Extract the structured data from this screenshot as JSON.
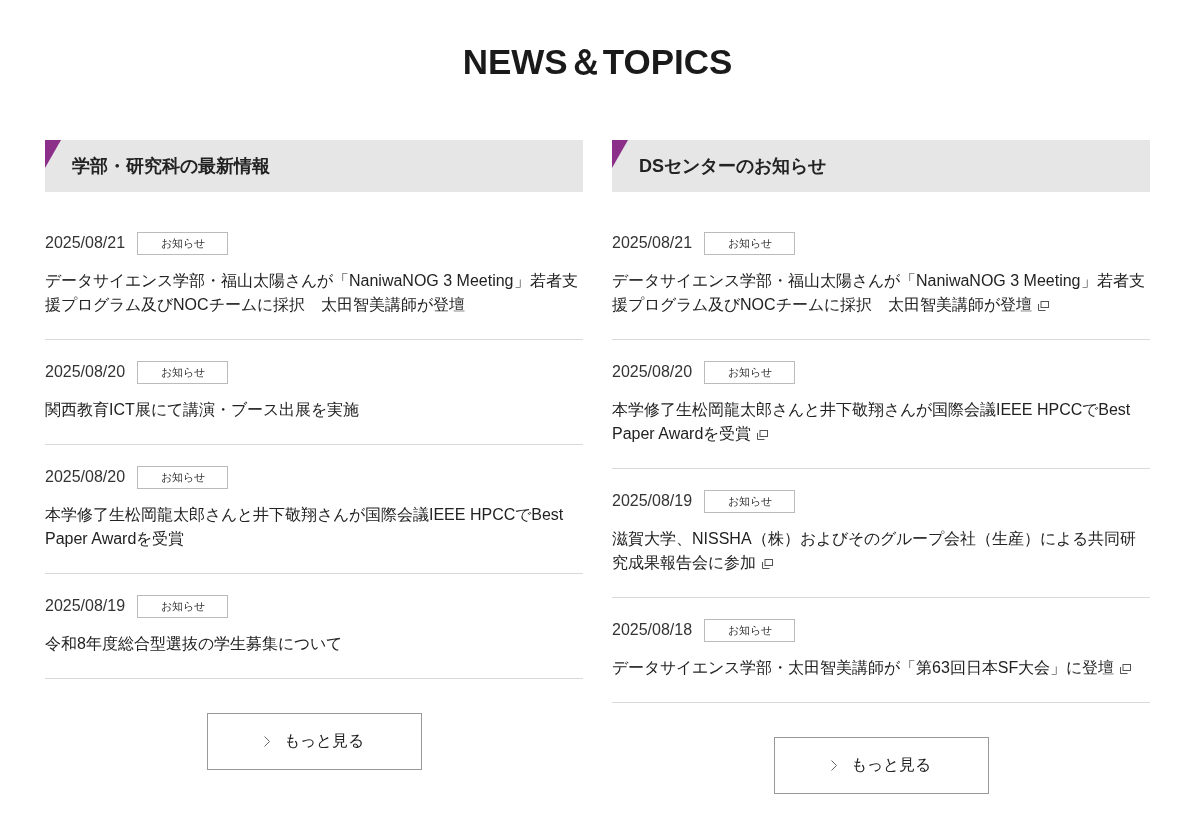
{
  "heading": "NEWS＆TOPICS",
  "columns": [
    {
      "title": "学部・研究科の最新情報",
      "items": [
        {
          "date": "2025/08/21",
          "category": "お知らせ",
          "title": "データサイエンス学部・福山太陽さんが「NaniwaNOG 3 Meeting」若者支援プログラム及びNOCチームに採択　太田智美講師が登壇",
          "external": false
        },
        {
          "date": "2025/08/20",
          "category": "お知らせ",
          "title": "関西教育ICT展にて講演・ブース出展を実施",
          "external": false
        },
        {
          "date": "2025/08/20",
          "category": "お知らせ",
          "title": "本学修了生松岡龍太郎さんと井下敬翔さんが国際会議IEEE HPCCでBest Paper Awardを受賞",
          "external": false
        },
        {
          "date": "2025/08/19",
          "category": "お知らせ",
          "title": "令和8年度総合型選抜の学生募集について",
          "external": false
        }
      ],
      "more_button": "もっと見る"
    },
    {
      "title": "DSセンターのお知らせ",
      "items": [
        {
          "date": "2025/08/21",
          "category": "お知らせ",
          "title": "データサイエンス学部・福山太陽さんが「NaniwaNOG 3 Meeting」若者支援プログラム及びNOCチームに採択　太田智美講師が登壇",
          "external": true
        },
        {
          "date": "2025/08/20",
          "category": "お知らせ",
          "title": "本学修了生松岡龍太郎さんと井下敬翔さんが国際会議IEEE HPCCでBest Paper Awardを受賞",
          "external": true
        },
        {
          "date": "2025/08/19",
          "category": "お知らせ",
          "title": "滋賀大学、NISSHA（株）およびそのグループ会社（生産）による共同研究成果報告会に参加",
          "external": true
        },
        {
          "date": "2025/08/18",
          "category": "お知らせ",
          "title": "データサイエンス学部・太田智美講師が「第63回日本SF大会」に登壇",
          "external": true
        }
      ],
      "more_button": "もっと見る"
    }
  ]
}
